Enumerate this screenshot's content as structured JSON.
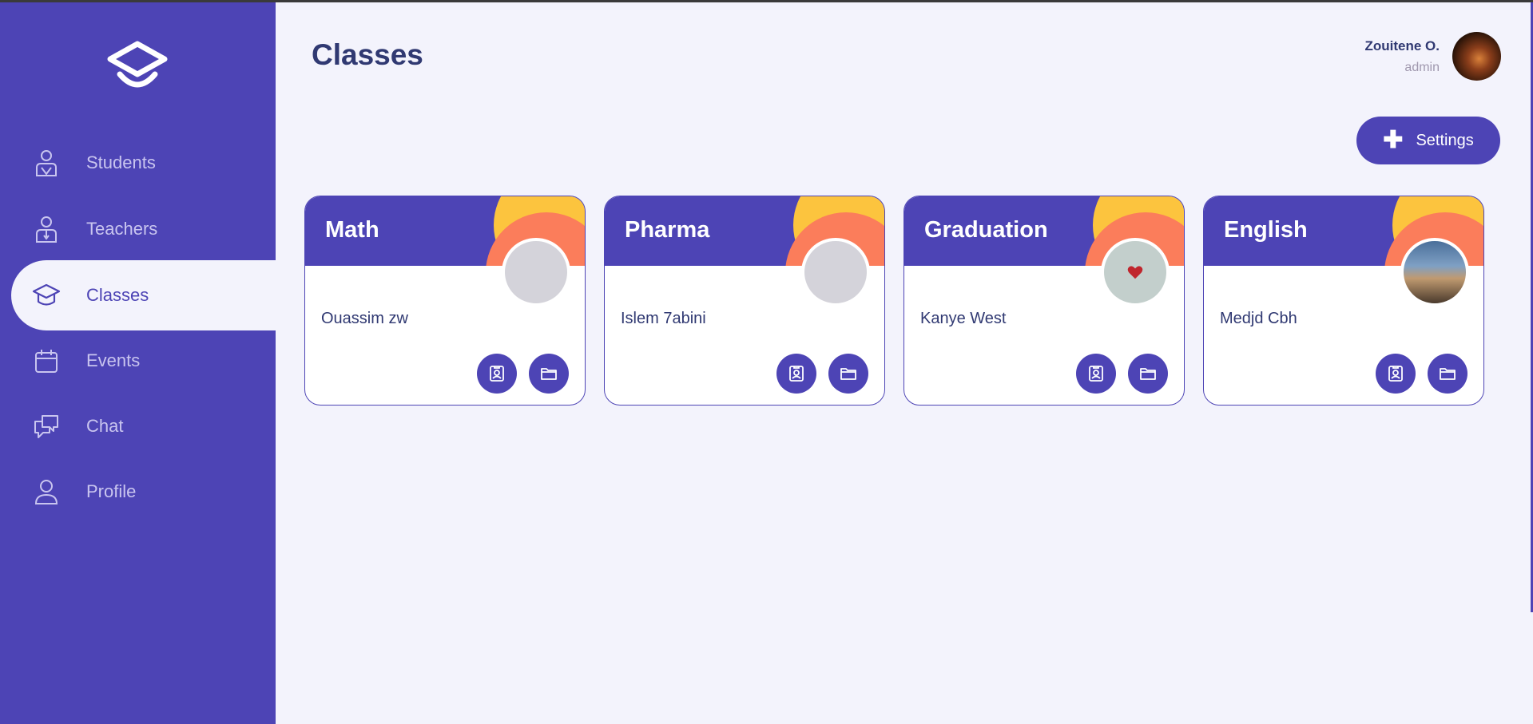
{
  "sidebar": {
    "items": [
      {
        "label": "Students",
        "icon": "student-icon"
      },
      {
        "label": "Teachers",
        "icon": "teacher-icon"
      },
      {
        "label": "Classes",
        "icon": "graduation-cap-icon",
        "active": true
      },
      {
        "label": "Events",
        "icon": "calendar-icon"
      },
      {
        "label": "Chat",
        "icon": "chat-icon"
      },
      {
        "label": "Profile",
        "icon": "user-icon"
      }
    ]
  },
  "header": {
    "title": "Classes",
    "user": {
      "name": "Zouitene O.",
      "role": "admin"
    }
  },
  "actions": {
    "settings_label": "Settings"
  },
  "classes": [
    {
      "name": "Math",
      "teacher": "Ouassim zw"
    },
    {
      "name": "Pharma",
      "teacher": "Islem 7abini"
    },
    {
      "name": "Graduation",
      "teacher": "Kanye West"
    },
    {
      "name": "English",
      "teacher": "Medjd Cbh"
    }
  ],
  "colors": {
    "primary": "#4d44b5",
    "background": "#f3f3fc",
    "accent_yellow": "#fcc43e",
    "accent_orange": "#fb7d5b",
    "text_dark": "#303972"
  }
}
